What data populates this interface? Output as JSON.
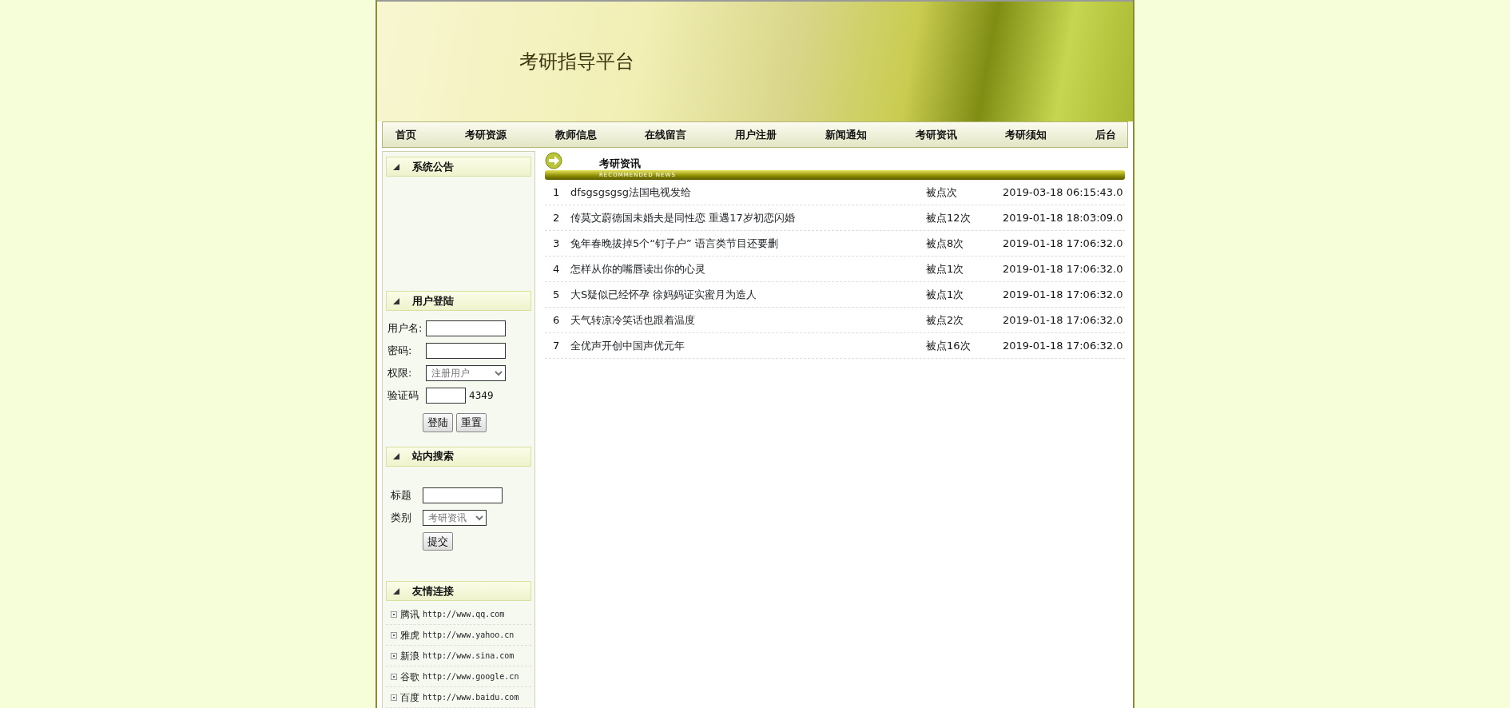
{
  "header": {
    "title": "考研指导平台"
  },
  "nav": [
    "首页",
    "考研资源",
    "教师信息",
    "在线留言",
    "用户注册",
    "新闻通知",
    "考研资讯",
    "考研须知",
    "后台"
  ],
  "sidebar": {
    "notice": {
      "title": "系统公告"
    },
    "login": {
      "title": "用户登陆",
      "fields": [
        {
          "label": "用户名:",
          "kind": "text"
        },
        {
          "label": "密码:",
          "kind": "password"
        },
        {
          "label": "权限:",
          "kind": "select",
          "value": "注册用户"
        },
        {
          "label": "验证码",
          "kind": "captcha",
          "code": "4349"
        }
      ],
      "buttons": [
        "登陆",
        "重置"
      ]
    },
    "search": {
      "title": "站内搜索",
      "fields": [
        {
          "label": "标题",
          "kind": "text"
        },
        {
          "label": "类别",
          "kind": "select",
          "value": "考研资讯"
        }
      ],
      "button": "提交"
    },
    "links": {
      "title": "友情连接",
      "items": [
        {
          "name": "腾讯",
          "url": "http://www.qq.com"
        },
        {
          "name": "雅虎",
          "url": "http://www.yahoo.cn"
        },
        {
          "name": "新浪",
          "url": "http://www.sina.com"
        },
        {
          "name": "谷歌",
          "url": "http://www.google.cn"
        },
        {
          "name": "百度",
          "url": "http://www.baidu.com"
        }
      ]
    }
  },
  "news": {
    "title": "考研资讯",
    "subtitle": "RECOMMENDED NEWS",
    "rows": [
      {
        "index": "1",
        "title": "dfsgsgsgsg法国电视发给",
        "clicks": "被点次",
        "time": "2019-03-18 06:15:43.0"
      },
      {
        "index": "2",
        "title": "传莫文蔚德国未婚夫是同性恋 重遇17岁初恋闪婚",
        "clicks": "被点12次",
        "time": "2019-01-18 18:03:09.0"
      },
      {
        "index": "3",
        "title": "兔年春晚拔掉5个“钉子户” 语言类节目还要删",
        "clicks": "被点8次",
        "time": "2019-01-18 17:06:32.0"
      },
      {
        "index": "4",
        "title": "怎样从你的嘴唇读出你的心灵",
        "clicks": "被点1次",
        "time": "2019-01-18 17:06:32.0"
      },
      {
        "index": "5",
        "title": "大S疑似已经怀孕 徐妈妈证实蜜月为造人",
        "clicks": "被点1次",
        "time": "2019-01-18 17:06:32.0"
      },
      {
        "index": "6",
        "title": "天气转凉冷笑话也跟着温度",
        "clicks": "被点2次",
        "time": "2019-01-18 17:06:32.0"
      },
      {
        "index": "7",
        "title": "全优声开创中国声优元年",
        "clicks": "被点16次",
        "time": "2019-01-18 17:06:32.0"
      }
    ]
  }
}
